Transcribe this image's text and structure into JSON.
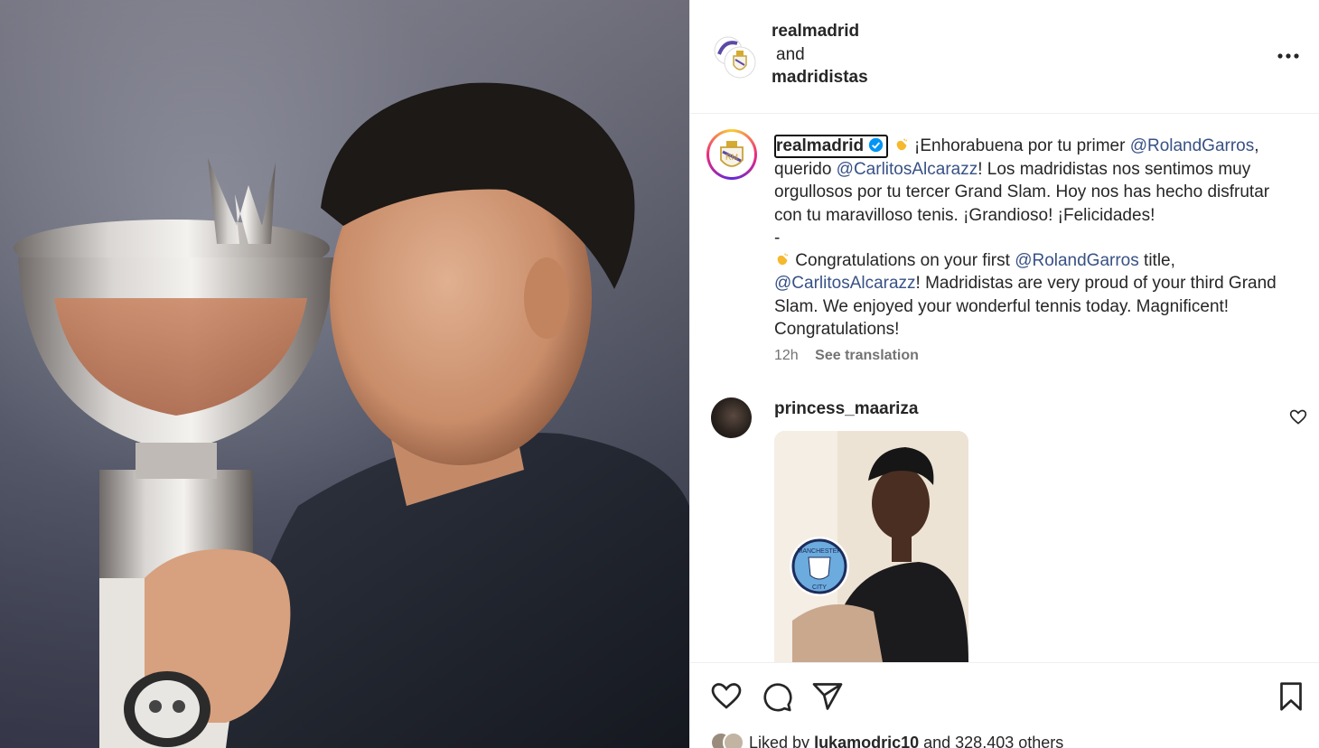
{
  "post": {
    "header": {
      "user1": "realmadrid",
      "conjunction": "and",
      "user2": "madridistas"
    },
    "caption": {
      "username": "realmadrid",
      "line_es_1_pre": "¡Enhorabuena por tu primer ",
      "mention_rg": "@RolandGarros",
      "line_es_1_post": ",",
      "line_es_2_pre": "querido ",
      "mention_ca": "@CarlitosAlcarazz",
      "line_es_2_post": "! Los madridistas nos sentimos muy orgullosos por tu tercer Grand Slam. Hoy nos has hecho disfrutar con tu maravilloso tenis. ¡Grandioso! ¡Felicidades!",
      "separator": "-",
      "line_en_1_pre": "Congratulations on your first ",
      "line_en_1_post": " title,",
      "line_en_2_post": "! Madridistas are very proud of your third Grand Slam. We enjoyed your wonderful tennis today. Magnificent! Congratulations!",
      "time": "12h",
      "see_translation": "See translation"
    },
    "comment": {
      "username": "princess_maariza"
    },
    "likes": {
      "prefix": "Liked by ",
      "user": "lukamodric10",
      "suffix": " and 328,403 others"
    }
  },
  "colors": {
    "mention": "#385185",
    "muted": "#737373",
    "verified": "#0095f6"
  }
}
